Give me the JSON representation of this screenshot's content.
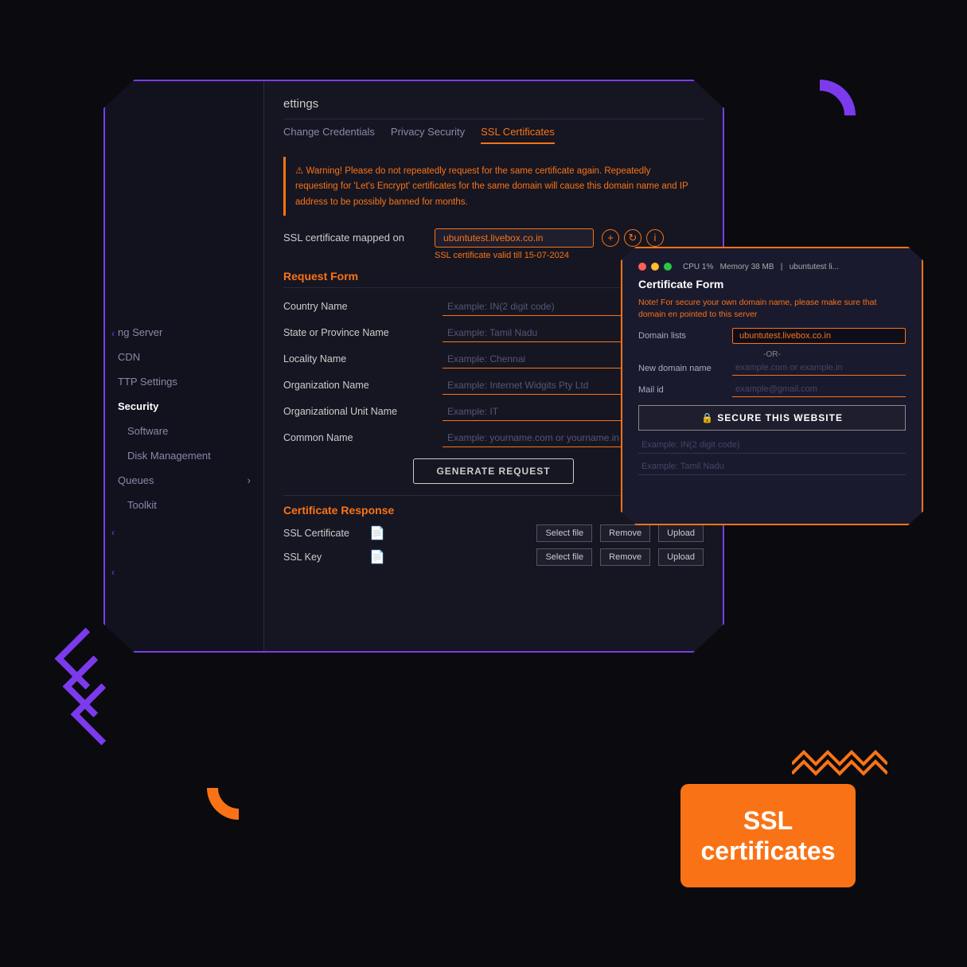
{
  "page": {
    "background": "#0a0a0f"
  },
  "settings": {
    "title": "ettings"
  },
  "tabs": [
    {
      "label": "Change Credentials",
      "active": false
    },
    {
      "label": "Privacy Security",
      "active": false
    },
    {
      "label": "SSL Certificates",
      "active": true
    }
  ],
  "warning": {
    "icon": "⚠",
    "text": "Warning! Please do not repeatedly request for the same certificate again. Repeatedly requesting for 'Let's Encrypt' certificates for the same domain will cause this domain name and IP address to be possibly banned for months."
  },
  "ssl_mapped": {
    "label": "SSL certificate mapped on",
    "value": "ubuntutest.livebox.co.in",
    "valid_text": "SSL certificate valid till 15-07-2024"
  },
  "request_form": {
    "title": "Request Form",
    "fields": [
      {
        "label": "Country Name",
        "placeholder": "Example: IN(2 digit code)"
      },
      {
        "label": "State or Province Name",
        "placeholder": "Example: Tamil Nadu"
      },
      {
        "label": "Locality Name",
        "placeholder": "Example: Chennai"
      },
      {
        "label": "Organization Name",
        "placeholder": "Example: Internet Widgits Pty Ltd"
      },
      {
        "label": "Organizational Unit Name",
        "placeholder": "Example: IT"
      },
      {
        "label": "Common Name",
        "placeholder": "Example: yourname.com or yourname.in"
      }
    ],
    "generate_btn": "GENERATE REQUEST"
  },
  "cert_response": {
    "title": "Certificate Response",
    "rows": [
      {
        "label": "SSL Certificate",
        "buttons": [
          "Select file",
          "Remove",
          "Upload"
        ]
      },
      {
        "label": "SSL Key",
        "buttons": [
          "Select file",
          "Remove",
          "Upload"
        ]
      }
    ]
  },
  "certificate_form": {
    "title": "Certificate Form",
    "note": "ote! For secure your own domain name, please make sure that domain en pointed to this server",
    "domain_list_label": "Domain lists",
    "domain_value": "ubuntutest.livebox.co.in",
    "or_text": "-OR-",
    "new_domain_label": "New domain name",
    "new_domain_placeholder": "example.com or example.in",
    "mail_label": "Mail id",
    "mail_placeholder": "example@gmail.com",
    "secure_btn": "🔒 SECURE THIS WEBSITE",
    "bottom_inputs": [
      {
        "placeholder": "Example: IN(2 digit code)"
      },
      {
        "placeholder": "Example: Tamil Nadu"
      }
    ]
  },
  "sidebar": {
    "items": [
      {
        "label": "ng Server",
        "active": false
      },
      {
        "label": "CDN",
        "active": false
      },
      {
        "label": "TTP Settings",
        "active": false
      },
      {
        "label": "Security",
        "active": true
      },
      {
        "label": "Software",
        "active": false
      },
      {
        "label": "Disk Management",
        "active": false
      },
      {
        "label": "Queues",
        "active": false,
        "arrow": true
      },
      {
        "label": "Toolkit",
        "active": false
      }
    ]
  },
  "ssl_label": {
    "line1": "SSL",
    "line2": "certificates"
  }
}
